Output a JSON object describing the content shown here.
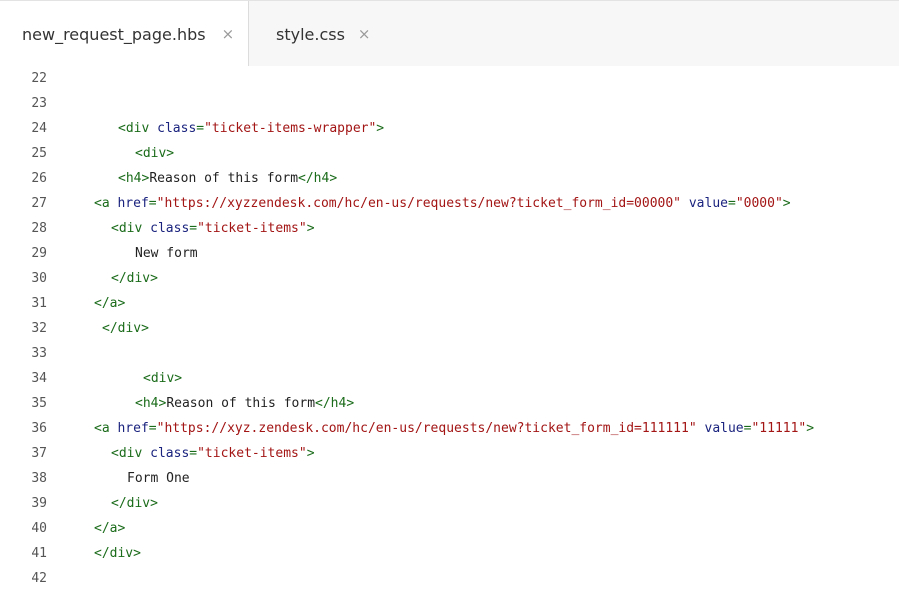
{
  "tabs": [
    {
      "label": "new_request_page.hbs",
      "close": "×"
    },
    {
      "label": "style.css",
      "close": "×"
    }
  ],
  "lines": [
    {
      "n": "22",
      "tokens": []
    },
    {
      "n": "23",
      "tokens": []
    },
    {
      "n": "24",
      "tokens": [
        [
          "tag",
          "<div "
        ],
        [
          "attr",
          "class"
        ],
        [
          "tag",
          "="
        ],
        [
          "str",
          "\"ticket-items-wrapper\""
        ],
        [
          "tag",
          ">"
        ]
      ]
    },
    {
      "n": "25",
      "tokens": [
        [
          "tag",
          "<div>"
        ]
      ]
    },
    {
      "n": "26",
      "tokens": [
        [
          "tag",
          "<h4>"
        ],
        [
          "txt",
          "Reason of this form"
        ],
        [
          "tag",
          "</h4>"
        ]
      ]
    },
    {
      "n": "27",
      "tokens": [
        [
          "tag",
          "<a "
        ],
        [
          "attr",
          "href"
        ],
        [
          "tag",
          "="
        ],
        [
          "str",
          "\"https://xyzzendesk.com/hc/en-us/requests/new?ticket_form_id=00000\""
        ],
        [
          "tag",
          " "
        ],
        [
          "attr",
          "value"
        ],
        [
          "tag",
          "="
        ],
        [
          "str",
          "\"0000\""
        ],
        [
          "tag",
          ">"
        ]
      ]
    },
    {
      "n": "28",
      "tokens": [
        [
          "tag",
          "<div "
        ],
        [
          "attr",
          "class"
        ],
        [
          "tag",
          "="
        ],
        [
          "str",
          "\"ticket-items\""
        ],
        [
          "tag",
          ">"
        ]
      ]
    },
    {
      "n": "29",
      "tokens": [
        [
          "txt",
          "New form"
        ]
      ]
    },
    {
      "n": "30",
      "tokens": [
        [
          "tag",
          "</div>"
        ]
      ]
    },
    {
      "n": "31",
      "tokens": [
        [
          "tag",
          "</a>"
        ]
      ]
    },
    {
      "n": "32",
      "tokens": [
        [
          "tag",
          "</div>"
        ]
      ]
    },
    {
      "n": "33",
      "tokens": []
    },
    {
      "n": "34",
      "tokens": [
        [
          "tag",
          "<div>"
        ]
      ]
    },
    {
      "n": "35",
      "tokens": [
        [
          "tag",
          "<h4>"
        ],
        [
          "txt",
          "Reason of this form"
        ],
        [
          "tag",
          "</h4>"
        ]
      ]
    },
    {
      "n": "36",
      "tokens": [
        [
          "tag",
          "<a "
        ],
        [
          "attr",
          "href"
        ],
        [
          "tag",
          "="
        ],
        [
          "str",
          "\"https://xyz.zendesk.com/hc/en-us/requests/new?ticket_form_id=111111\""
        ],
        [
          "tag",
          " "
        ],
        [
          "attr",
          "value"
        ],
        [
          "tag",
          "="
        ],
        [
          "str",
          "\"11111\""
        ],
        [
          "tag",
          ">"
        ]
      ]
    },
    {
      "n": "37",
      "tokens": [
        [
          "tag",
          "<div "
        ],
        [
          "attr",
          "class"
        ],
        [
          "tag",
          "="
        ],
        [
          "str",
          "\"ticket-items\""
        ],
        [
          "tag",
          ">"
        ]
      ]
    },
    {
      "n": "38",
      "tokens": [
        [
          "txt",
          "Form One"
        ]
      ]
    },
    {
      "n": "39",
      "tokens": [
        [
          "tag",
          "</div>"
        ]
      ]
    },
    {
      "n": "40",
      "tokens": [
        [
          "tag",
          "</a>"
        ]
      ]
    },
    {
      "n": "41",
      "tokens": [
        [
          "tag",
          "</div>"
        ]
      ]
    },
    {
      "n": "42",
      "tokens": []
    }
  ],
  "colors": {
    "tag": "#1a6b1a",
    "attribute": "#1a237e",
    "string": "#a31515",
    "text": "#222222",
    "line_number": "#555555"
  }
}
